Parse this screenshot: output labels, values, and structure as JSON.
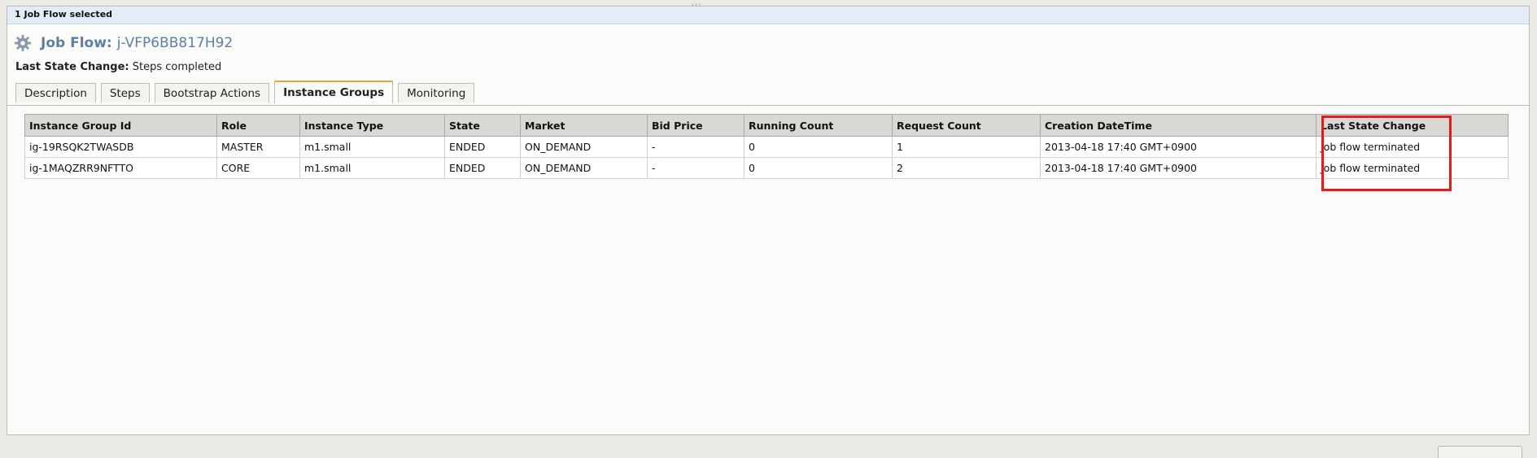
{
  "selection": {
    "text": "1 Job Flow selected"
  },
  "job_flow": {
    "label": "Job Flow:",
    "id": "j-VFP6BB817H92",
    "icon": "gear-icon",
    "last_state_change_label": "Last State Change:",
    "last_state_change_value": "Steps completed"
  },
  "tabs": [
    {
      "label": "Description",
      "active": false
    },
    {
      "label": "Steps",
      "active": false
    },
    {
      "label": "Bootstrap Actions",
      "active": false
    },
    {
      "label": "Instance Groups",
      "active": true
    },
    {
      "label": "Monitoring",
      "active": false
    }
  ],
  "table": {
    "columns": [
      "Instance Group Id",
      "Role",
      "Instance Type",
      "State",
      "Market",
      "Bid Price",
      "Running Count",
      "Request Count",
      "Creation DateTime",
      "Last State Change"
    ],
    "rows": [
      [
        "ig-19RSQK2TWASDB",
        "MASTER",
        "m1.small",
        "ENDED",
        "ON_DEMAND",
        "-",
        "0",
        "1",
        "2013-04-18 17:40 GMT+0900",
        "Job flow terminated"
      ],
      [
        "ig-1MAQZRR9NFTTO",
        "CORE",
        "m1.small",
        "ENDED",
        "ON_DEMAND",
        "-",
        "0",
        "2",
        "2013-04-18 17:40 GMT+0900",
        "Job flow terminated"
      ]
    ]
  },
  "colors": {
    "accent_tab": "#f0a33d",
    "title": "#5d7fa6",
    "highlight": "#e01b1b"
  }
}
